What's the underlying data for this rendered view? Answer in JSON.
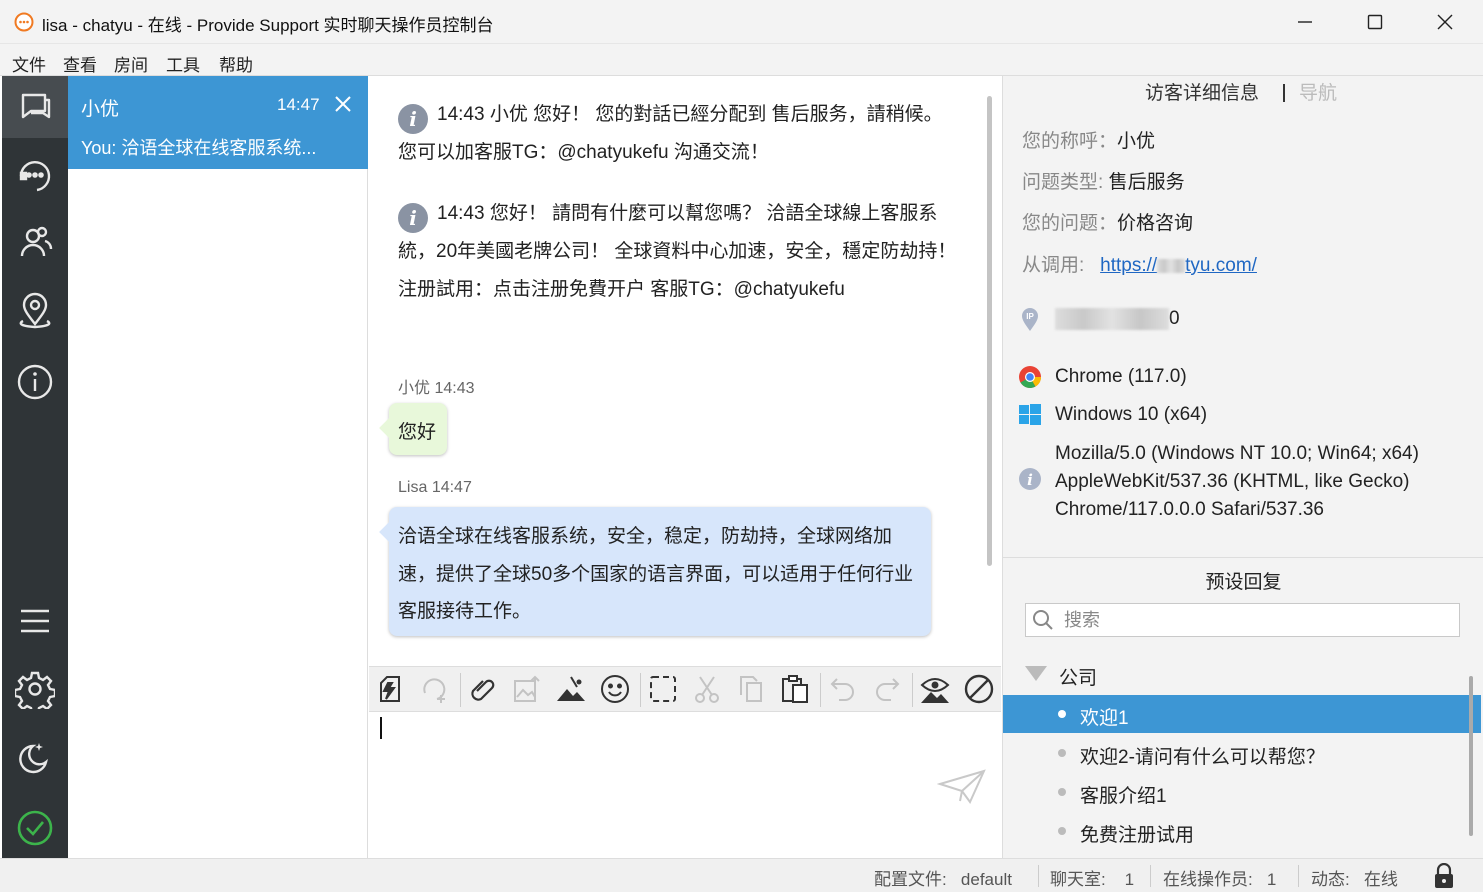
{
  "window": {
    "title": "lisa - chatyu - 在线 - Provide Support 实时聊天操作员控制台"
  },
  "menu": [
    "文件",
    "查看",
    "房间",
    "工具",
    "帮助"
  ],
  "rail_icons": [
    "chats-icon",
    "operator-headset-icon",
    "visitors-icon",
    "location-pin-icon",
    "info-icon",
    "menu-icon",
    "settings-icon",
    "moon-stars-icon",
    "online-check-icon"
  ],
  "chat_list": {
    "active": {
      "name": "小优",
      "time": "14:47",
      "preview": "You: 洽语全球在线客服系统..."
    }
  },
  "conversation": {
    "system_messages": [
      {
        "time": "14:43",
        "text": " 小优 您好！ 您的對話已經分配到 售后服务，請稍候。 您可以加客服TG：@chatyukefu 沟通交流！"
      },
      {
        "time": "14:43",
        "text": " 您好！ 請問有什麼可以幫您嗎？ 洽語全球線上客服系統，20年美國老牌公司！ 全球資料中心加速，安全，穩定防劫持！ 注册試用：点击注册免費开户 客服TG：@chatyukefu"
      }
    ],
    "messages": [
      {
        "sender": "小优",
        "time": "14:43",
        "text": "您好"
      },
      {
        "sender": "Lisa",
        "time": "14:47",
        "text": "洽语全球在线客服系统，安全，稳定，防劫持，全球网络加速，提供了全球50多个国家的语言界面，可以适用于任何行业客服接待工作。"
      }
    ]
  },
  "toolbar_icons": [
    "quick-reply-icon",
    "ai-assist-icon",
    "attach-icon",
    "send-image-icon",
    "screenshot-icon",
    "emoji-icon",
    "select-area-icon",
    "cut-icon",
    "copy-icon",
    "paste-icon",
    "undo-icon",
    "redo-icon",
    "co-browse-icon",
    "block-icon"
  ],
  "input": {
    "value": ""
  },
  "details": {
    "tab_active": "访客详细信息",
    "tab_other": "导航",
    "fields": [
      {
        "label": "您的称呼：",
        "value": "小优"
      },
      {
        "label": "问题类型:",
        "value": "售后服务"
      },
      {
        "label": "您的问题：",
        "value": "价格咨询"
      }
    ],
    "referrer_label": "从调用:",
    "referrer_prefix": "https://",
    "referrer_suffix": "tyu.com/",
    "ip_suffix": "0",
    "browser": "Chrome (117.0)",
    "os": "Windows 10 (x64)",
    "user_agent": "Mozilla/5.0 (Windows NT 10.0; Win64; x64) AppleWebKit/537.36 (KHTML, like Gecko) Chrome/117.0.0.0 Safari/537.36"
  },
  "canned": {
    "title": "预设回复",
    "search_placeholder": "搜索",
    "folder": "公司",
    "items": [
      "欢迎1",
      "欢迎2-请问有什么可以帮您？",
      "客服介绍1",
      "免费注册试用"
    ],
    "selected_index": 0
  },
  "status": {
    "profile_label": "配置文件:",
    "profile_value": "default",
    "rooms_label": "聊天室:",
    "rooms_value": "1",
    "operators_label": "在线操作员:",
    "operators_value": "1",
    "state_label": "动态:",
    "state_value": "在线"
  },
  "colors": {
    "accent": "#3d96d4",
    "rail": "#2f3437",
    "bubble_visitor": "#e8f8da",
    "bubble_operator": "#d7e6fb",
    "online": "#3cb44b"
  }
}
